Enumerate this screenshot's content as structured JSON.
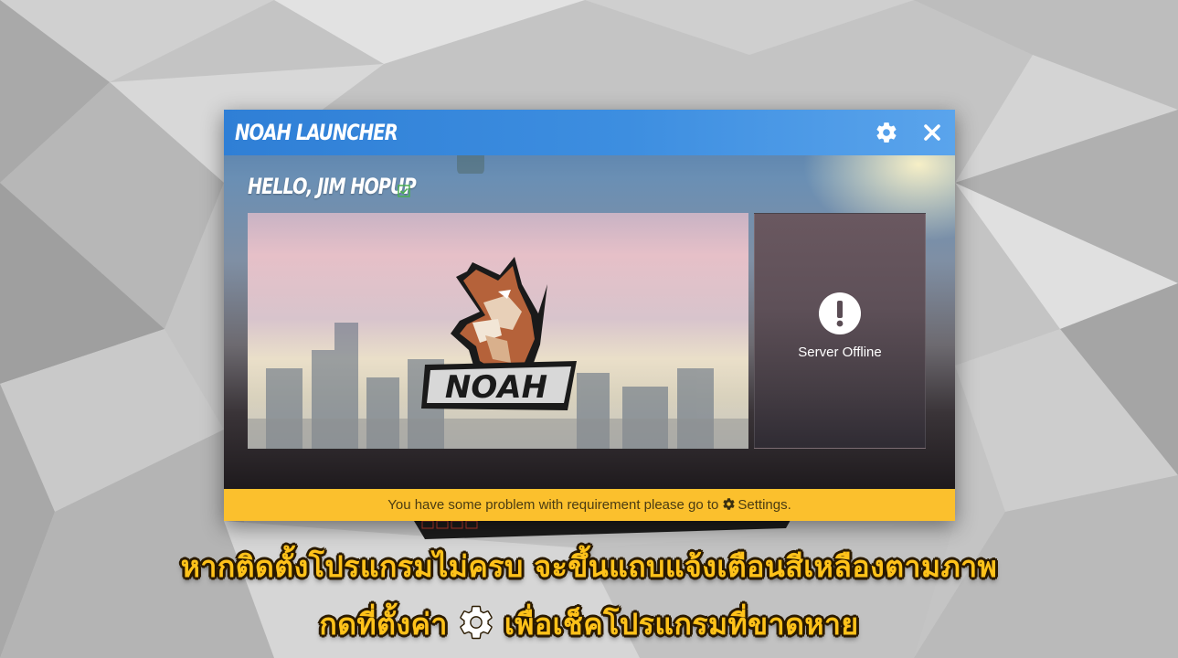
{
  "launcher": {
    "title": "NOAH LAUNCHER",
    "greeting": "HELLO, JIM HOPUP",
    "banner_logo_text": "NOAH",
    "server_status": "Server Offline",
    "warning": {
      "text_before": "You have some problem with requirement please go to",
      "link_label": "Settings."
    }
  },
  "icons": {
    "settings": "gear-icon",
    "close": "close-icon",
    "verified": "check-box-icon",
    "alert": "exclamation-circle-icon"
  },
  "colors": {
    "titlebar": "#3d8ee0",
    "warning_bar": "#fbc02d",
    "caption_text": "#ffc21a",
    "verified": "#4caf50"
  },
  "caption": {
    "line1": "หากติดตั้งโปรแกรมไม่ครบ จะขึ้นแถบแจ้งเตือนสีเหลืองตามภาพ",
    "line2_before": "กดที่ตั้งค่า",
    "line2_after": "เพื่อเช็คโปรแกรมที่ขาดหาย"
  }
}
